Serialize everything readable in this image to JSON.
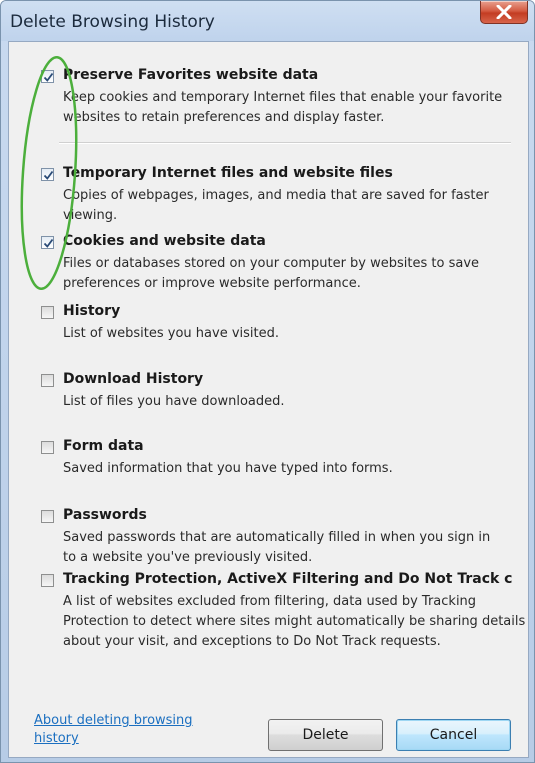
{
  "window": {
    "title": "Delete Browsing History"
  },
  "options": [
    {
      "label": "Preserve Favorites website data",
      "description": "Keep cookies and temporary Internet files that enable your favorite websites to retain preferences and display faster.",
      "checked": true
    },
    {
      "label": "Temporary Internet files and website files",
      "description": "Copies of webpages, images, and media that are saved for faster viewing.",
      "checked": true
    },
    {
      "label": "Cookies and website data",
      "description": "Files or databases stored on your computer by websites to save preferences or improve website performance.",
      "checked": true
    },
    {
      "label": "History",
      "description": "List of websites you have visited.",
      "checked": false
    },
    {
      "label": "Download History",
      "description": "List of files you have downloaded.",
      "checked": false
    },
    {
      "label": "Form data",
      "description": "Saved information that you have typed into forms.",
      "checked": false
    },
    {
      "label": "Passwords",
      "description": "Saved passwords that are automatically filled in when you sign in to a website you've previously visited.",
      "checked": false
    },
    {
      "label": "Tracking Protection, ActiveX Filtering and Do Not Track c",
      "description": "A list of websites excluded from filtering, data used by Tracking Protection to detect where sites might automatically be sharing details about your visit, and exceptions to Do Not Track requests.",
      "checked": false
    }
  ],
  "footer": {
    "about_link": "About deleting browsing history",
    "delete_label": "Delete",
    "cancel_label": "Cancel"
  },
  "colors": {
    "title_bar": "#bfd3ec",
    "close_button": "#c33d22",
    "link": "#1b6fc0",
    "annotation": "#4caf3c"
  },
  "icons": {
    "close": "close-x-icon",
    "check": "checkmark-icon"
  }
}
